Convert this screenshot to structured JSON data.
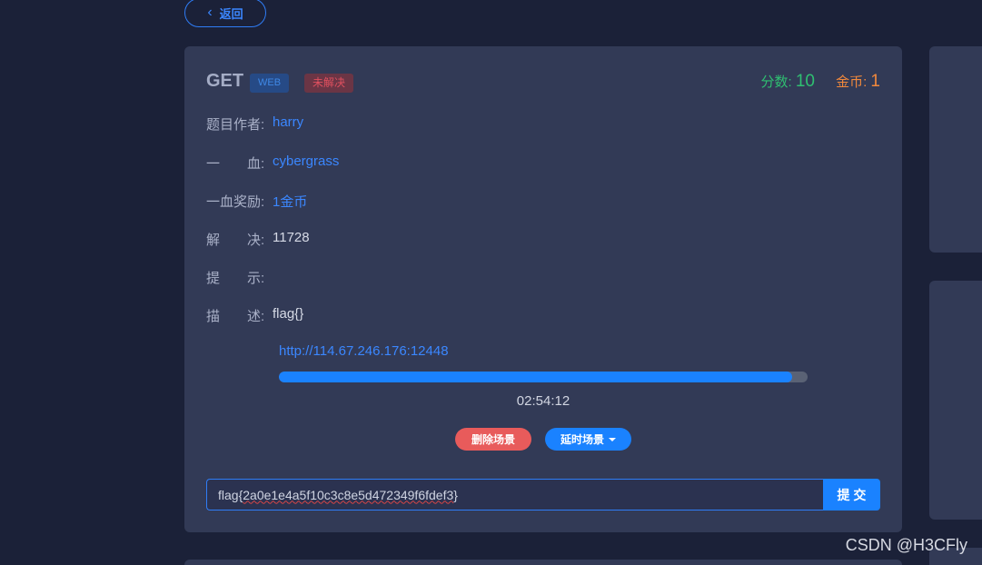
{
  "nav": {
    "back_label": "返回"
  },
  "challenge": {
    "title": "GET",
    "category_badge": "WEB",
    "status_badge": "未解决",
    "score_label": "分数:",
    "score_value": "10",
    "coin_label": "金币:",
    "coin_value": "1",
    "fields": {
      "author_label": "题目作者:",
      "author_value": "harry",
      "first_blood_label": "一　　血:",
      "first_blood_value": "cybergrass",
      "first_blood_reward_label": "一血奖励:",
      "first_blood_reward_value": "1金币",
      "solved_label": "解　　决:",
      "solved_value": "11728",
      "hint_label": "提　　示:",
      "hint_value": "",
      "description_label": "描　　述:",
      "description_value": "flag{}"
    },
    "scene": {
      "url": "http://114.67.246.176:12448",
      "progress_fraction": 0.97,
      "timer": "02:54:12",
      "delete_button": "删除场景",
      "extend_button": "延时场景"
    },
    "submit": {
      "flag_prefix": "flag{",
      "flag_body": "2a0e1e4a5f10c3c8e5d472349f6fdef3",
      "flag_suffix": "}",
      "submit_label": "提 交"
    }
  },
  "watermark": "CSDN @H3CFly",
  "colors": {
    "accent": "#1a82ff",
    "danger": "#e85b5b",
    "score": "#2fbf71",
    "coin": "#f0883c",
    "card": "#323a56",
    "background": "#1b2138"
  }
}
